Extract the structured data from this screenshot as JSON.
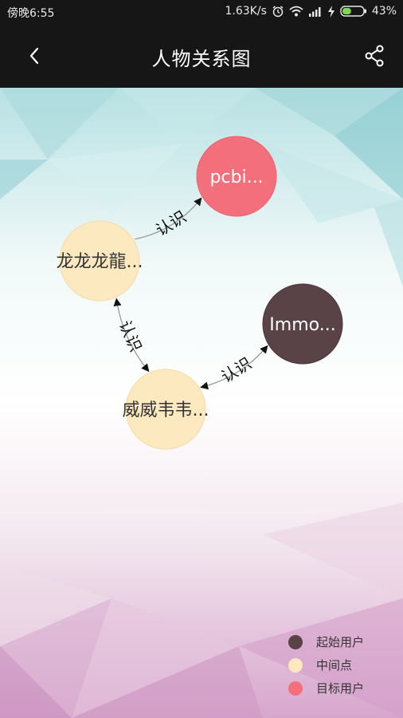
{
  "status_bar": {
    "carrier_time": "傍晚6:55",
    "network_speed": "1.63K/s",
    "battery": "43%",
    "battery_level": 0.43
  },
  "app_bar": {
    "title": "人物关系图"
  },
  "graph": {
    "nodes": [
      {
        "id": "n1",
        "label": "pcbi...",
        "role": "target",
        "color": "#f46f7c"
      },
      {
        "id": "n2",
        "label": "龙龙龙龍...",
        "role": "middle",
        "color": "#fde9bf"
      },
      {
        "id": "n3",
        "label": "Immo...",
        "role": "start",
        "color": "#5a4346"
      },
      {
        "id": "n4",
        "label": "威威韦韦...",
        "role": "middle",
        "color": "#fde9bf"
      }
    ],
    "edges": [
      {
        "from": "n2",
        "to": "n1",
        "label": "认识"
      },
      {
        "from": "n2",
        "to": "n4",
        "label": "认识"
      },
      {
        "from": "n3",
        "to": "n4",
        "label": "认识"
      }
    ]
  },
  "legend": {
    "items": [
      {
        "label": "起始用户",
        "color": "#5a4346"
      },
      {
        "label": "中间点",
        "color": "#fde9bf"
      },
      {
        "label": "目标用户",
        "color": "#f46f7c"
      }
    ]
  }
}
